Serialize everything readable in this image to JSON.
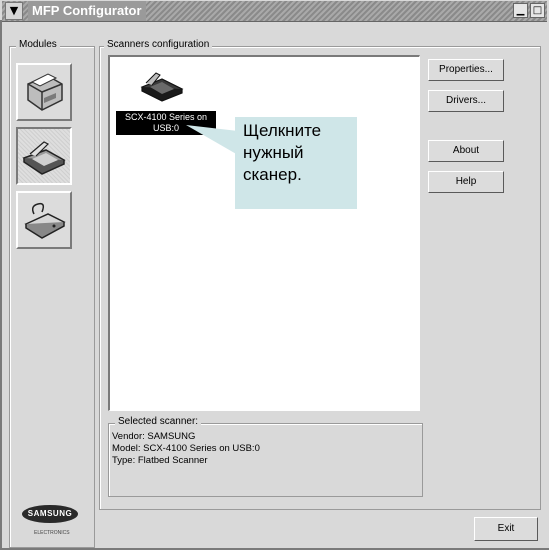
{
  "window": {
    "title": "MFP Configurator",
    "menu_icon": "chevron-down-icon",
    "minimize_label": "▁",
    "maximize_label": "□",
    "close_label": "✕"
  },
  "modules": {
    "legend": "Modules",
    "items": [
      {
        "name": "printer",
        "icon": "printer-icon",
        "selected": false
      },
      {
        "name": "scanner",
        "icon": "scanner-icon",
        "selected": true
      },
      {
        "name": "port",
        "icon": "port-icon",
        "selected": false
      }
    ],
    "logo_text": "SAMSUNG",
    "logo_sub": "ELECTRONICS"
  },
  "scanners": {
    "legend": "Scanners configuration",
    "items": [
      {
        "label": "SCX-4100 Series on USB:0",
        "icon": "scanner-icon",
        "selected": true
      }
    ]
  },
  "callout": {
    "text": "Щелкните нужный сканер.",
    "background": "#cfe6e8"
  },
  "buttons": {
    "properties": "Properties...",
    "drivers": "Drivers...",
    "about": "About",
    "help": "Help",
    "exit": "Exit"
  },
  "selected": {
    "legend": "Selected scanner:",
    "vendor": "Vendor: SAMSUNG",
    "model": "Model: SCX-4100 Series on USB:0",
    "type": "Type: Flatbed Scanner"
  }
}
